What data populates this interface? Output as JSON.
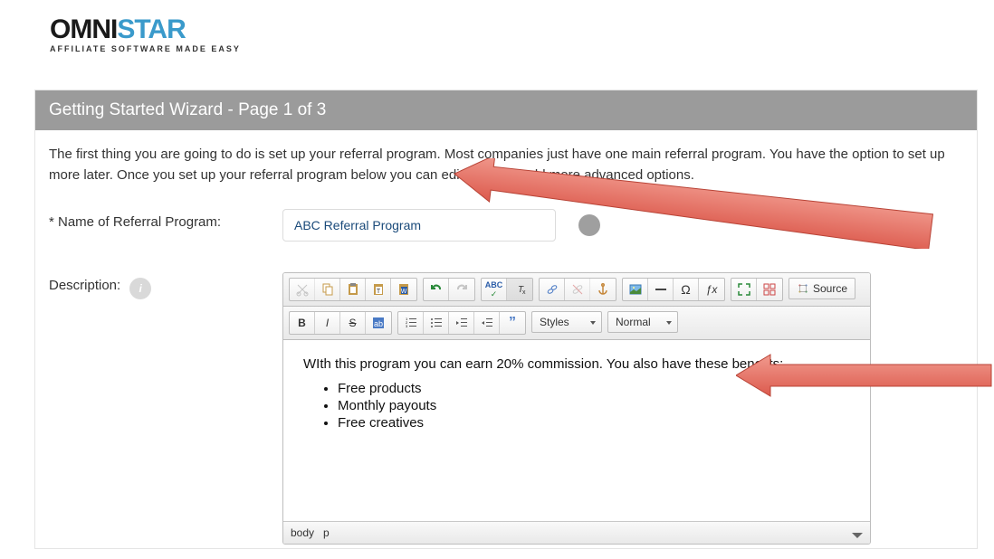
{
  "logo": {
    "omni": "OMNI",
    "star": "STAR",
    "tagline": "AFFILIATE SOFTWARE MADE EASY"
  },
  "panel": {
    "title": "Getting Started Wizard - Page 1 of 3"
  },
  "intro": "The first thing you are going to do is set up your referral program. Most companies just have one main referral program. You have the option to set up more later. Once you set up your referral program below you can edit it later to add more advanced options.",
  "fields": {
    "name_label": "* Name of Referral Program:",
    "name_value": "ABC Referral Program",
    "desc_label": "Description:"
  },
  "toolbar": {
    "styles": "Styles",
    "format": "Normal",
    "source": "Source",
    "spell": "ABC"
  },
  "editor_content": {
    "line": "WIth this program you can earn 20% commission. You also have these benefits:",
    "bullets": [
      "Free products",
      "Monthly payouts",
      "Free creatives"
    ]
  },
  "path": {
    "seg1": "body",
    "seg2": "p"
  },
  "arrow_color": "#e57368"
}
